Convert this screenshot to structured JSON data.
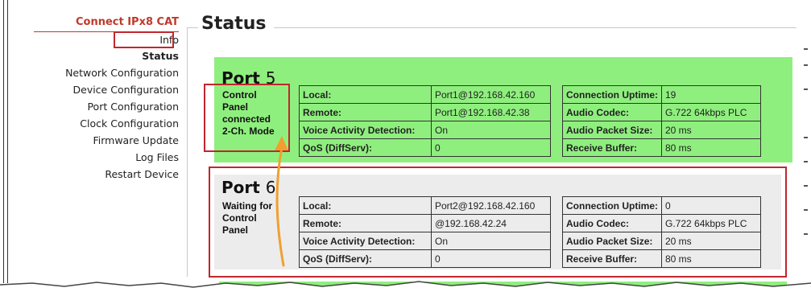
{
  "sidebar": {
    "title": "Connect IPx8 CAT",
    "items": [
      {
        "label": "Info"
      },
      {
        "label": "Status"
      },
      {
        "label": "Network Configuration"
      },
      {
        "label": "Device Configuration"
      },
      {
        "label": "Port Configuration"
      },
      {
        "label": "Clock Configuration"
      },
      {
        "label": "Firmware Update"
      },
      {
        "label": "Log Files"
      },
      {
        "label": "Restart Device"
      }
    ]
  },
  "main": {
    "heading": "Status"
  },
  "ports": [
    {
      "label": "Port",
      "number": "5",
      "status_lines": [
        "Control",
        "Panel",
        "connected",
        "2-Ch. Mode"
      ],
      "left": [
        {
          "k": "Local:",
          "v": "Port1@192.168.42.160"
        },
        {
          "k": "Remote:",
          "v": "Port1@192.168.42.38"
        },
        {
          "k": "Voice Activity Detection:",
          "v": "On"
        },
        {
          "k": "QoS (DiffServ):",
          "v": "0"
        }
      ],
      "right": [
        {
          "k": "Connection Uptime:",
          "v": "19"
        },
        {
          "k": "Audio Codec:",
          "v": "G.722 64kbps PLC"
        },
        {
          "k": "Audio Packet Size:",
          "v": "20 ms"
        },
        {
          "k": "Receive Buffer:",
          "v": "80 ms"
        }
      ]
    },
    {
      "label": "Port",
      "number": "6",
      "status_lines": [
        "Waiting for",
        "Control",
        "Panel"
      ],
      "left": [
        {
          "k": "Local:",
          "v": "Port2@192.168.42.160"
        },
        {
          "k": "Remote:",
          "v": "@192.168.42.24"
        },
        {
          "k": "Voice Activity Detection:",
          "v": "On"
        },
        {
          "k": "QoS (DiffServ):",
          "v": "0"
        }
      ],
      "right": [
        {
          "k": "Connection Uptime:",
          "v": "0"
        },
        {
          "k": "Audio Codec:",
          "v": "G.722 64kbps PLC"
        },
        {
          "k": "Audio Packet Size:",
          "v": "20 ms"
        },
        {
          "k": "Receive Buffer:",
          "v": "80 ms"
        }
      ]
    }
  ],
  "colors": {
    "connected_bg": "#8fef7e",
    "waiting_bg": "#ececec",
    "highlight": "#c0262d",
    "arrow": "#f0a030",
    "title": "#c0392b"
  }
}
